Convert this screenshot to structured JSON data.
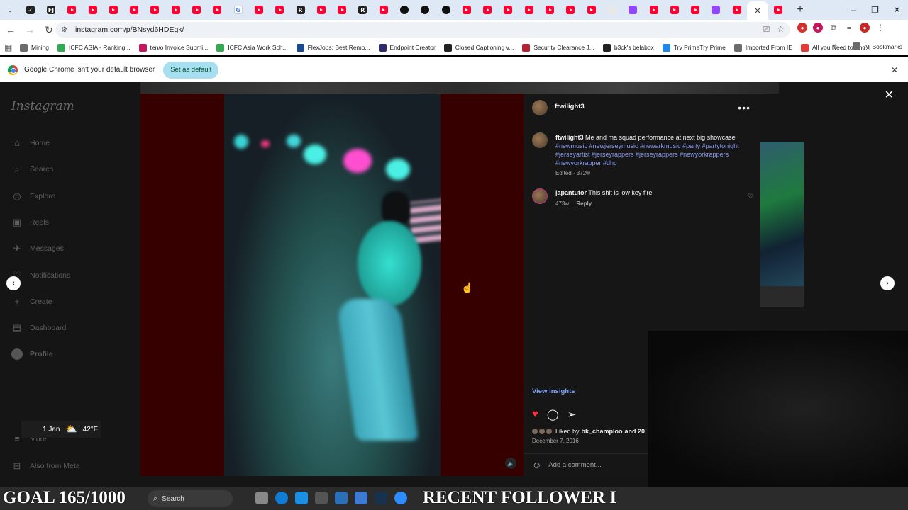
{
  "browser": {
    "url": "instagram.com/p/BNsyd6HDEgk/",
    "tabs": [
      {
        "kind": "dark",
        "glyph": "✓"
      },
      {
        "kind": "dark",
        "glyph": "FJ"
      },
      {
        "kind": "yt"
      },
      {
        "kind": "yt"
      },
      {
        "kind": "yt"
      },
      {
        "kind": "yt"
      },
      {
        "kind": "yt"
      },
      {
        "kind": "yt"
      },
      {
        "kind": "yt"
      },
      {
        "kind": "yt"
      },
      {
        "kind": "g",
        "glyph": "G"
      },
      {
        "kind": "yt"
      },
      {
        "kind": "yt"
      },
      {
        "kind": "dark",
        "glyph": "R"
      },
      {
        "kind": "yt"
      },
      {
        "kind": "yt"
      },
      {
        "kind": "dark",
        "glyph": "R"
      },
      {
        "kind": "yt"
      },
      {
        "kind": "circ"
      },
      {
        "kind": "circ"
      },
      {
        "kind": "circ"
      },
      {
        "kind": "yt"
      },
      {
        "kind": "yt"
      },
      {
        "kind": "yt"
      },
      {
        "kind": "yt"
      },
      {
        "kind": "yt"
      },
      {
        "kind": "yt"
      },
      {
        "kind": "yt"
      },
      {
        "kind": "lt"
      },
      {
        "kind": "tw"
      },
      {
        "kind": "yt"
      },
      {
        "kind": "yt"
      },
      {
        "kind": "yt"
      },
      {
        "kind": "tw"
      },
      {
        "kind": "yt"
      },
      {
        "kind": "active"
      },
      {
        "kind": "yt"
      }
    ],
    "bookmarks": [
      {
        "label": "Mining",
        "color": "#6b6b6b"
      },
      {
        "label": "ICFC ASIA - Ranking...",
        "color": "#34a853"
      },
      {
        "label": "ten/o Invoice Submi...",
        "color": "#c2185b"
      },
      {
        "label": "ICFC Asia Work Sch...",
        "color": "#34a853"
      },
      {
        "label": "FlexJobs: Best Remo...",
        "color": "#1a4b8c"
      },
      {
        "label": "Endpoint Creator",
        "color": "#2d2a6e"
      },
      {
        "label": "Closed Captioning v...",
        "color": "#222"
      },
      {
        "label": "Security Clearance J...",
        "color": "#b22234"
      },
      {
        "label": "b3ck's belabox",
        "color": "#222"
      },
      {
        "label": "Try PrimeTry Prime",
        "color": "#1e88e5"
      },
      {
        "label": "Imported From IE",
        "color": "#6b6b6b"
      },
      {
        "label": "All you Need to Kno...",
        "color": "#e53935"
      }
    ],
    "all_bookmarks": "All Bookmarks",
    "infobar_text": "Google Chrome isn't your default browser",
    "infobar_button": "Set as default"
  },
  "instagram": {
    "logo": "Instagram",
    "nav": [
      {
        "label": "Home",
        "icon": "home-icon"
      },
      {
        "label": "Search",
        "icon": "search-icon"
      },
      {
        "label": "Explore",
        "icon": "compass-icon"
      },
      {
        "label": "Reels",
        "icon": "reels-icon"
      },
      {
        "label": "Messages",
        "icon": "messages-icon"
      },
      {
        "label": "Notifications",
        "icon": "heart-icon"
      },
      {
        "label": "Create",
        "icon": "plus-icon"
      },
      {
        "label": "Dashboard",
        "icon": "dashboard-icon"
      },
      {
        "label": "Profile",
        "icon": "profile-icon"
      }
    ],
    "more": "More",
    "also_from_meta": "Also from Meta",
    "post": {
      "username": "ftwilight3",
      "caption_user": "ftwilight3",
      "caption_text": "Me and ma squad performance at next big showcase",
      "caption_tags": "#newmusic #newjerseymusic #newarkmusic #party #partytonight #jerseyartist #jerseyrappers #jerseyrappers #newyorkrappers #newyorkrapper #dhc",
      "caption_meta": "Edited · 372w",
      "comment_user": "japantutor",
      "comment_text": "This shit is low key fire",
      "comment_time": "473w",
      "comment_reply": "Reply",
      "view_insights": "View insights",
      "liked_by_prefix": "Liked by",
      "liked_by_user": "bk_champloo",
      "liked_by_suffix": "and 20",
      "date": "December 7, 2016",
      "add_comment_placeholder": "Add a comment..."
    }
  },
  "overlay": {
    "weather_date": "1 Jan",
    "weather_temp": "42°F",
    "goal_text": "GOAL 165/1000",
    "recent_text": "RECENT FOLLOWER I",
    "taskbar_search": "Search"
  },
  "colors": {
    "heart": "#ff3040",
    "link": "#8c9cf0",
    "accent": "#7ea2f3"
  }
}
